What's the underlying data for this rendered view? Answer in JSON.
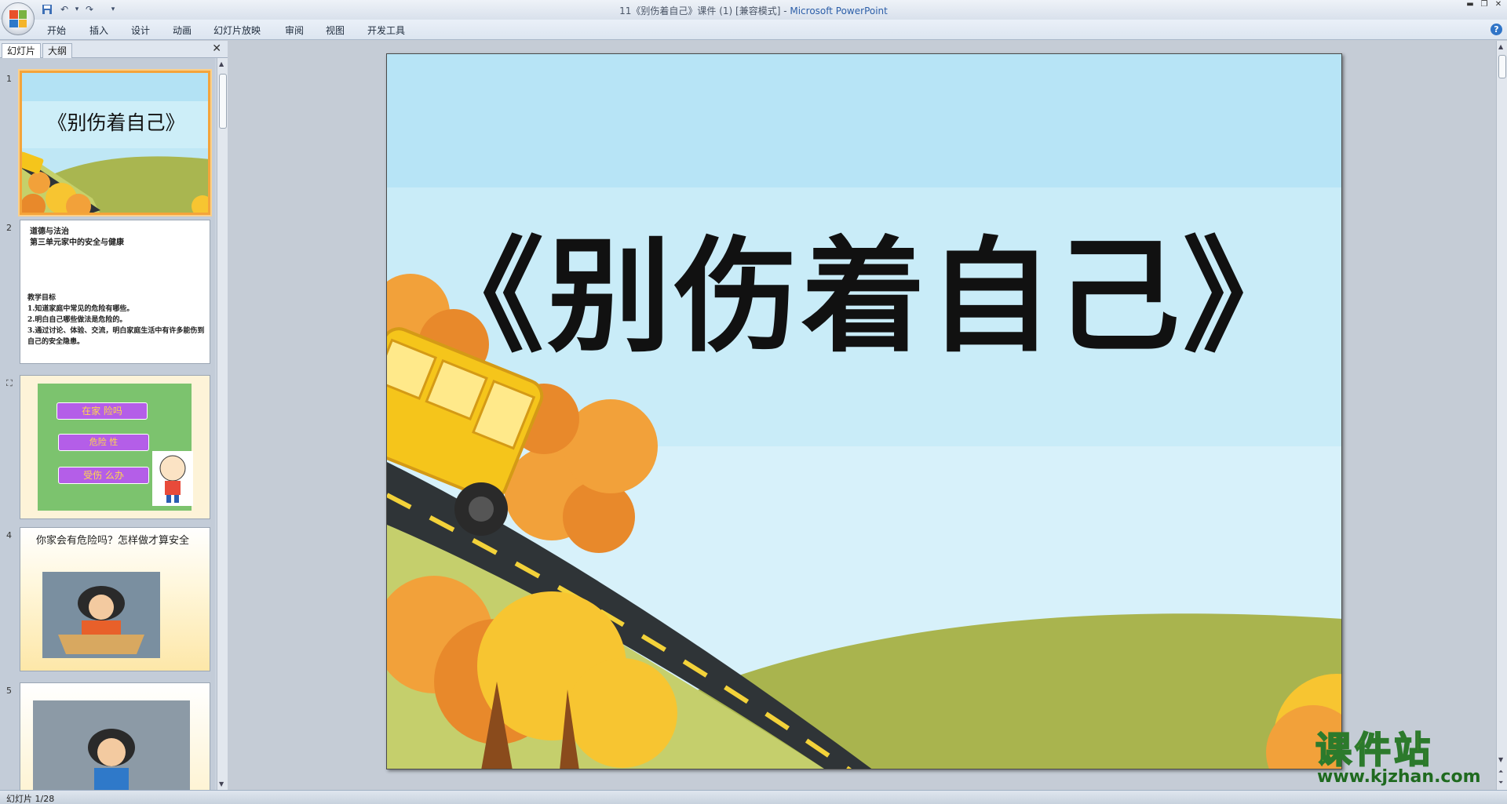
{
  "window": {
    "doc_title": "11《别伤着自己》课件 (1) [兼容模式] - ",
    "app_name": "Microsoft PowerPoint"
  },
  "ribbon": {
    "tabs": [
      "开始",
      "插入",
      "设计",
      "动画",
      "幻灯片放映",
      "审阅",
      "视图",
      "开发工具"
    ]
  },
  "left_pane": {
    "tab_slides": "幻灯片",
    "tab_outline": "大纲",
    "slides": [
      {
        "number": "1",
        "title": "《别伤着自己》"
      },
      {
        "number": "2",
        "line1": "道德与法治",
        "line2": "第三单元家中的安全与健康",
        "goals_title": "教学目标",
        "goal1": "1.知道家庭中常见的危险有哪些。",
        "goal2": "2.明白自己哪些做法是危险的。",
        "goal3": "3.通过讨论、体验、交流，明白家庭生活中有许多能伤到自己的安全隐患。"
      },
      {
        "number": "3",
        "btn1": "在家 险吗",
        "btn2": "危险 性",
        "btn3": "受伤 么办"
      },
      {
        "number": "4",
        "text": "你家会有危险吗？怎样做才算安全"
      },
      {
        "number": "5"
      }
    ]
  },
  "slide": {
    "title": "《别伤着自己》"
  },
  "statusbar": {
    "slide_counter": "幻灯片 1/28"
  },
  "watermark": {
    "brand": "课件站",
    "url": "www.kjzhan.com"
  },
  "colors": {
    "sky": "#bfe7f5",
    "hill": "#aab750",
    "road": "#2f3437",
    "bus": "#f5c51b",
    "tree_orange": "#f2a13a",
    "thumb_highlight": "#f4a43a"
  }
}
